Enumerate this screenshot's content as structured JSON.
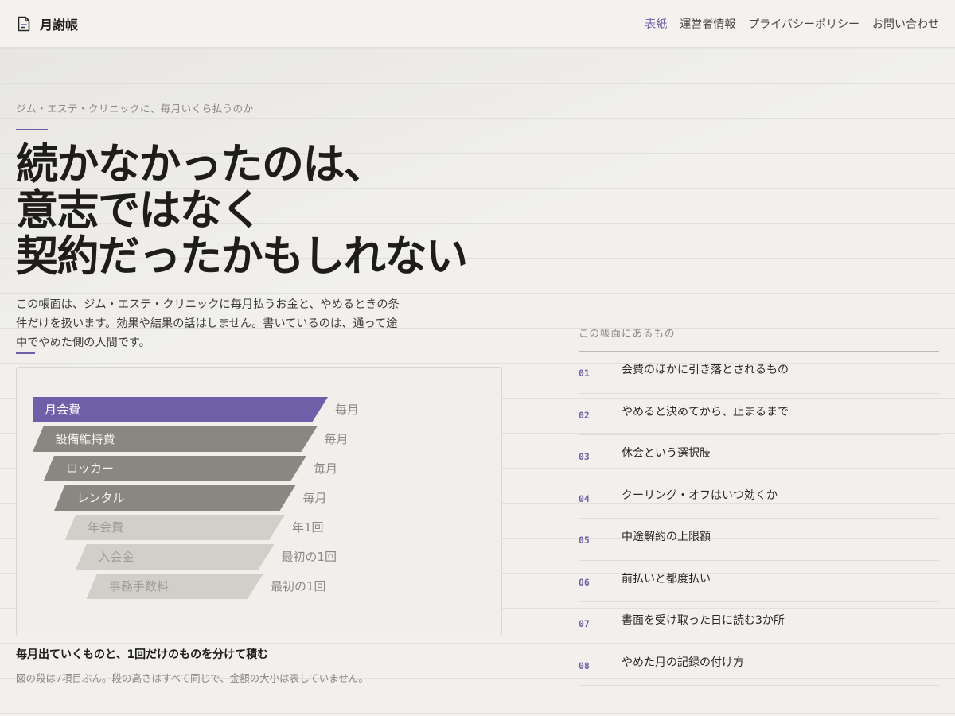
{
  "header": {
    "brand": "月謝帳",
    "brand_icon": "document-icon",
    "nav": [
      {
        "label": "表紙",
        "active": true
      },
      {
        "label": "運営者情報",
        "active": false
      },
      {
        "label": "プライバシーポリシー",
        "active": false
      },
      {
        "label": "お問い合わせ",
        "active": false
      }
    ]
  },
  "hero": {
    "eyebrow": "ジム・エステ・クリニックに、毎月いくら払うのか",
    "title_lines": [
      "続かなかったのは、",
      "意志ではなく",
      "契約だったかもしれない"
    ],
    "intro_lines": [
      "この帳面は、ジム・エステ・クリニックに毎月払うお金と、やめるときの条",
      "件だけを扱います。効果や結果の話はしません。書いているのは、通って途",
      "中でやめた側の人間です。"
    ]
  },
  "diagram": {
    "tiers": [
      {
        "label": "月会費",
        "frequency": "毎月",
        "style": "highlight"
      },
      {
        "label": "設備維持費",
        "frequency": "毎月",
        "style": "recurring"
      },
      {
        "label": "ロッカー",
        "frequency": "毎月",
        "style": "recurring"
      },
      {
        "label": "レンタル",
        "frequency": "毎月",
        "style": "recurring"
      },
      {
        "label": "年会費",
        "frequency": "年1回",
        "style": "occasional"
      },
      {
        "label": "入会金",
        "frequency": "最初の1回",
        "style": "occasional"
      },
      {
        "label": "事務手数料",
        "frequency": "最初の1回",
        "style": "occasional"
      }
    ],
    "colors": {
      "highlight": "#6f5fa8",
      "recurring": "#8a8781",
      "occasional": "#d2cfc8",
      "label_light": "#ffffff",
      "label_recurring": "#f4f3f1",
      "label_occasional": "#a09c96"
    },
    "caption": "毎月出ていくものと、1回だけのものを分けて積む",
    "note": "図の段は7項目ぶん。段の高さはすべて同じで、金額の大小は表していません。"
  },
  "toc": {
    "title": "この帳面にあるもの",
    "items": [
      {
        "num": "01",
        "label": "会費のほかに引き落とされるもの"
      },
      {
        "num": "02",
        "label": "やめると決めてから、止まるまで"
      },
      {
        "num": "03",
        "label": "休会という選択肢"
      },
      {
        "num": "04",
        "label": "クーリング・オフはいつ効くか"
      },
      {
        "num": "05",
        "label": "中途解約の上限額"
      },
      {
        "num": "06",
        "label": "前払いと都度払い"
      },
      {
        "num": "07",
        "label": "書面を受け取った日に読む3か所"
      },
      {
        "num": "08",
        "label": "やめた月の記録の付け方"
      }
    ]
  }
}
